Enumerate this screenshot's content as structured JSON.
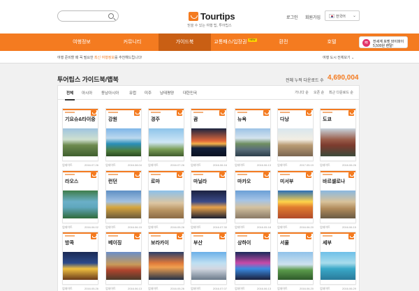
{
  "header": {
    "logo_text": "Tourtips",
    "tagline": "믿을 수 있는 여행 팁, 투어팁스",
    "login": "로그인",
    "signup": "회원가입",
    "language": "한국어"
  },
  "nav": {
    "items": [
      "여행정보",
      "커뮤니티",
      "가이드북",
      "교통패스/입장권",
      "환전",
      "호텔"
    ],
    "new_badge": "NEW",
    "promo_line1": "전세계 포켓 와이파이",
    "promo_line2": "5,500원 렌탈!"
  },
  "notice": {
    "prefix": "여행 준비할 때 꼭 필요한 ",
    "highlight": "최신 여행정보",
    "suffix": "를 추천해드립니다!",
    "right": "여행 도시 전체보기"
  },
  "section": {
    "title": "투어팁스 가이드북/맵북",
    "download_label": "전체 누적 다운로드 수",
    "download_count": "4,690,004"
  },
  "tabs": [
    "전체",
    "아시아",
    "동남아시아",
    "유럽",
    "미주",
    "남태평양",
    "대한민국"
  ],
  "sort": [
    "가나다 순",
    "오픈 순",
    "최근 다운로드 순"
  ],
  "cards": [
    {
      "title": "기요슈&타이중",
      "publisher": "업데이트",
      "date": "2016.07.26"
    },
    {
      "title": "강원",
      "publisher": "업데이트",
      "date": "2016.08.04"
    },
    {
      "title": "경주",
      "publisher": "업데이트",
      "date": "2016.07.26"
    },
    {
      "title": "괌",
      "publisher": "업데이트",
      "date": "2016.06.16"
    },
    {
      "title": "뉴욕",
      "publisher": "업데이트",
      "date": "2016.06.13"
    },
    {
      "title": "다낭",
      "publisher": "업데이트",
      "date": "2017.05.19"
    },
    {
      "title": "도쿄",
      "publisher": "업데이트",
      "date": "2016.06.26"
    },
    {
      "title": "라오스",
      "publisher": "업데이트",
      "date": "2016.06.02"
    },
    {
      "title": "런던",
      "publisher": "업데이트",
      "date": "2016.06.15"
    },
    {
      "title": "로마",
      "publisher": "업데이트",
      "date": "2016.05.26"
    },
    {
      "title": "마닐라",
      "publisher": "업데이트",
      "date": "2016.07.30"
    },
    {
      "title": "마카오",
      "publisher": "업데이트",
      "date": "2016.05.18"
    },
    {
      "title": "미서부",
      "publisher": "업데이트",
      "date": "2016.06.20"
    },
    {
      "title": "바르셀로나",
      "publisher": "업데이트",
      "date": "2016.06.15"
    },
    {
      "title": "방콕",
      "publisher": "업데이트",
      "date": "2016.05.26"
    },
    {
      "title": "베이징",
      "publisher": "업데이트",
      "date": "2016.06.13"
    },
    {
      "title": "보라카이",
      "publisher": "업데이트",
      "date": "2016.05.26"
    },
    {
      "title": "부산",
      "publisher": "업데이트",
      "date": "2016.07.07"
    },
    {
      "title": "상하이",
      "publisher": "업데이트",
      "date": "2016.06.13"
    },
    {
      "title": "서울",
      "publisher": "업데이트",
      "date": "2016.06.20"
    },
    {
      "title": "세부",
      "publisher": "업데이트",
      "date": "2016.06.29"
    }
  ],
  "colors": {
    "brand": "#f47b20",
    "nav_active": "#c95f14"
  }
}
